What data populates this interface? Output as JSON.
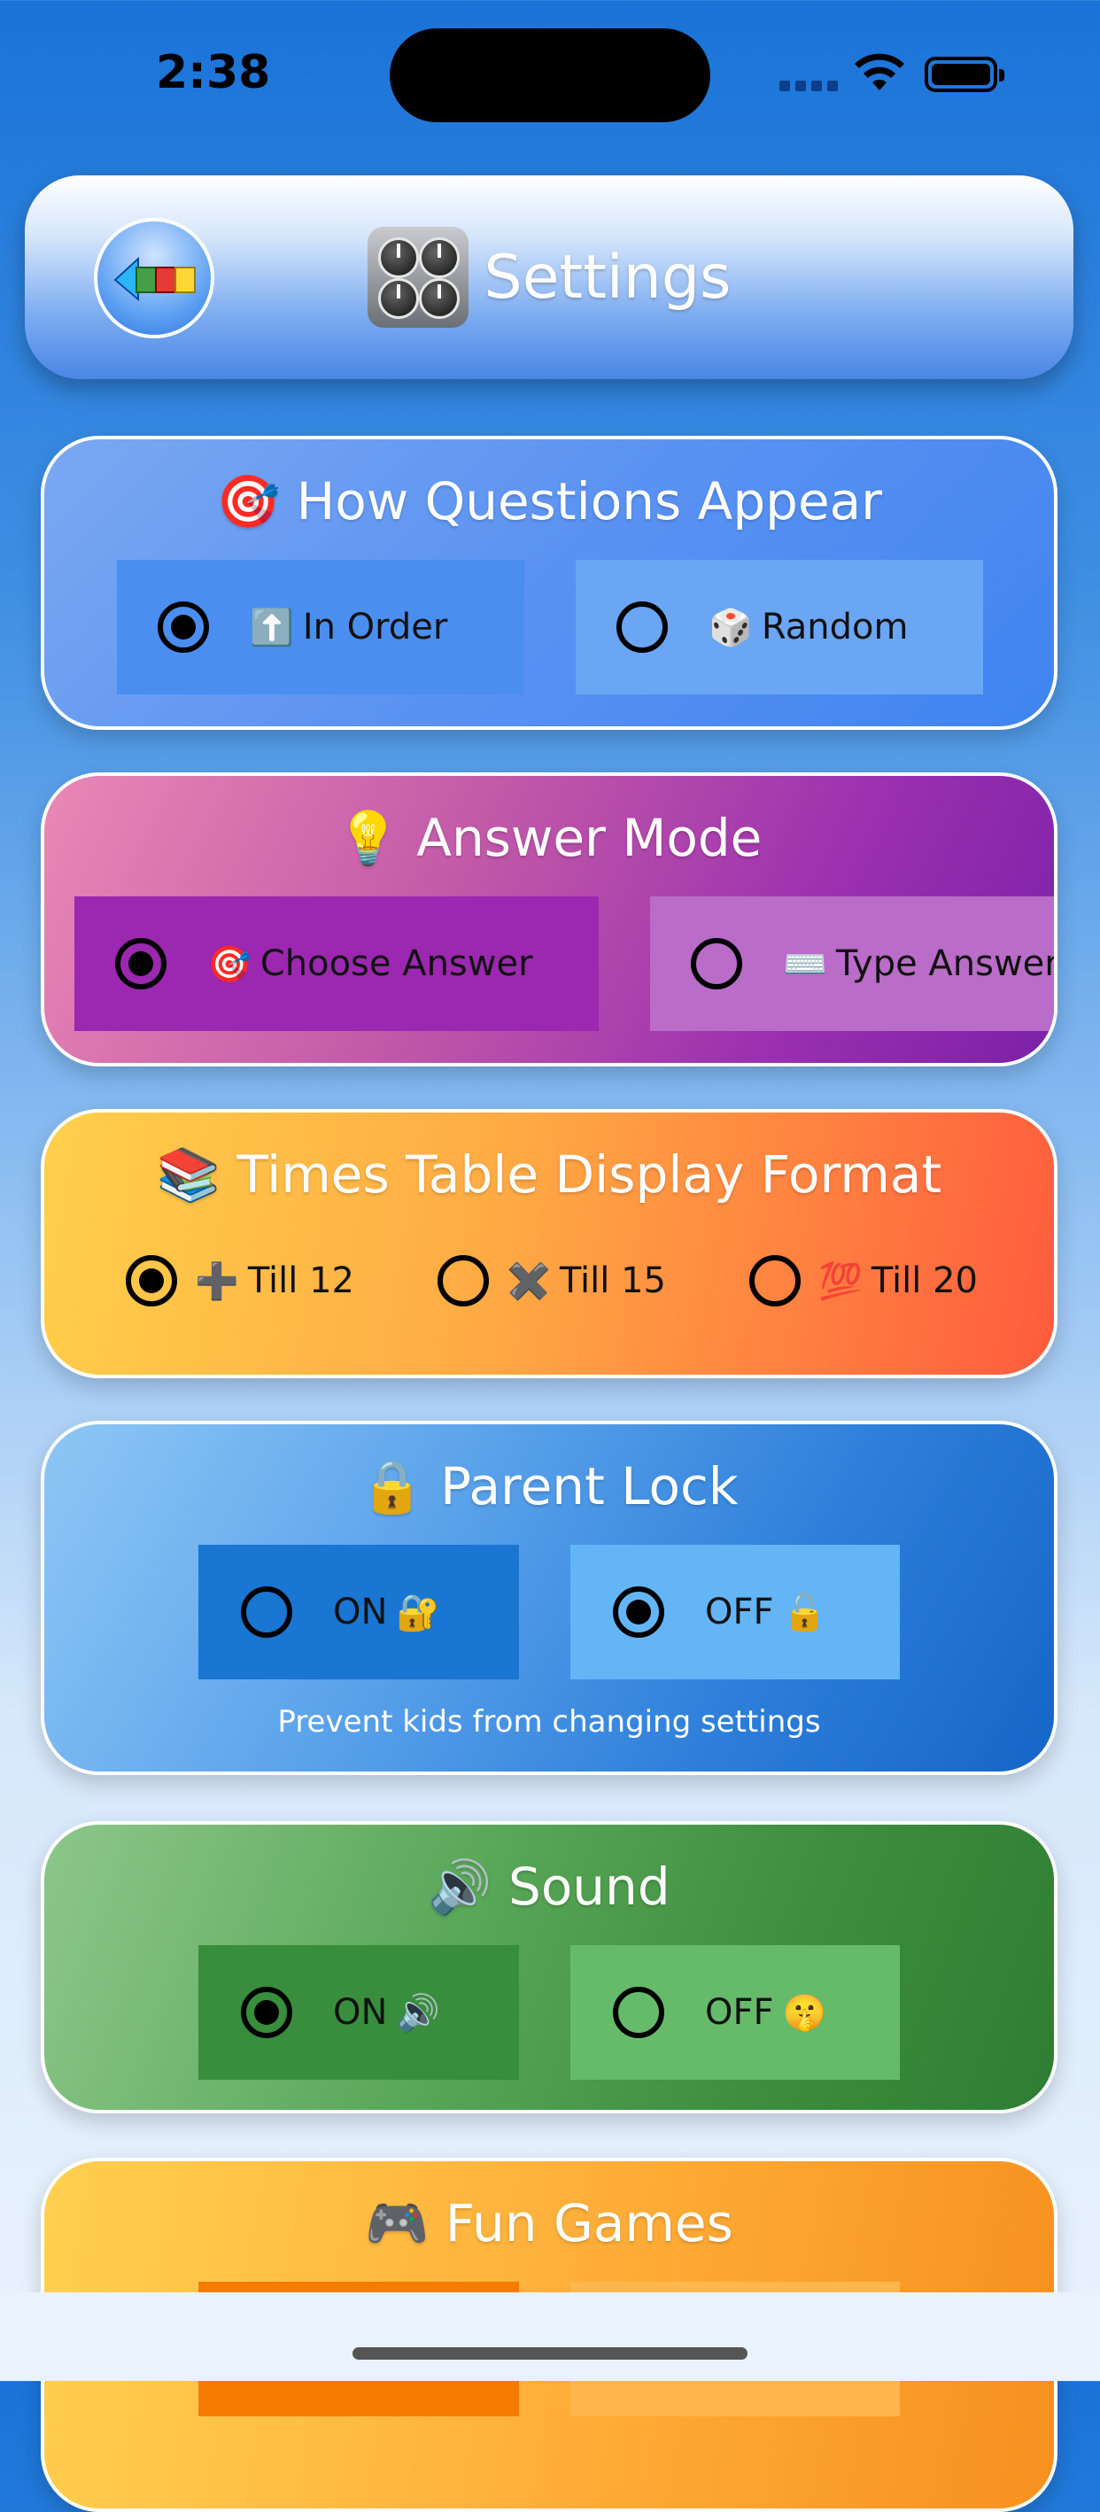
{
  "status_bar": {
    "time": "2:38"
  },
  "header": {
    "title": "Settings",
    "back_icon": "colorful-arrow-left-icon",
    "title_icon": "control-knobs-icon"
  },
  "sections": {
    "question_order": {
      "icon": "🎯",
      "title": "How Questions Appear",
      "options": [
        {
          "icon": "⬆️",
          "label": "In Order",
          "selected": true
        },
        {
          "icon": "🎲",
          "label": "Random",
          "selected": false
        }
      ]
    },
    "answer_mode": {
      "icon": "💡",
      "title": "Answer Mode",
      "options": [
        {
          "icon": "🎯",
          "label": "Choose Answer",
          "selected": true
        },
        {
          "icon": "⌨️",
          "label": "Type Answer",
          "selected": false
        }
      ]
    },
    "display_format": {
      "icon": "📚",
      "title": "Times Table Display Format",
      "options": [
        {
          "icon": "➕",
          "label": "Till 12",
          "selected": true
        },
        {
          "icon": "✖️",
          "label": "Till 15",
          "selected": false
        },
        {
          "icon": "💯",
          "label": "Till 20",
          "selected": false
        }
      ]
    },
    "parent_lock": {
      "icon": "🔒",
      "title": "Parent Lock",
      "options": [
        {
          "label": "ON",
          "icon": "🔐",
          "selected": false
        },
        {
          "label": "OFF",
          "icon": "🔓",
          "selected": true
        }
      ],
      "caption": "Prevent kids from changing settings"
    },
    "sound": {
      "icon": "🔊",
      "title": "Sound",
      "options": [
        {
          "label": "ON",
          "icon": "🔊",
          "selected": true
        },
        {
          "label": "OFF",
          "icon": "🤫",
          "selected": false
        }
      ]
    },
    "fun_games": {
      "icon": "🎮",
      "title": "Fun Games"
    }
  },
  "colors": {
    "background_top": "#1a73d8",
    "order_selected": "#4a8ef0",
    "order_unselected": "#6aa6f3",
    "answer_selected": "#9c27b0",
    "answer_unselected": "#b96cc8",
    "lock_selected": "#63b5f6",
    "lock_unselected": "#1976d2",
    "sound_selected": "#388e3c",
    "sound_unselected": "#66bb6a",
    "games_selected": "#f57c00",
    "games_unselected": "#ffb74d"
  }
}
